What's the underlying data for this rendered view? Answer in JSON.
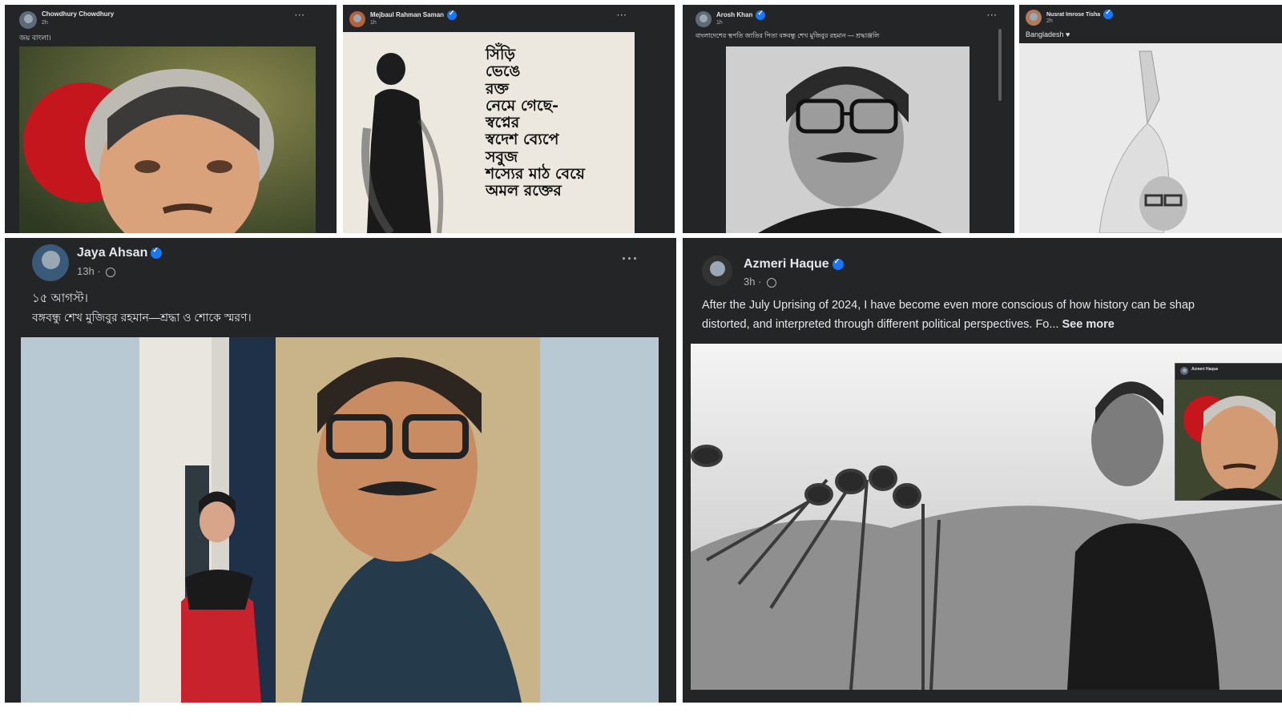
{
  "posts": [
    {
      "name": "Chowdhury Chowdhury",
      "time": "2h",
      "caption": "জয় বাংলা।"
    },
    {
      "name": "Mejbaul Rahman Saman",
      "time": "1h",
      "caption": ""
    },
    {
      "name": "Arosh Khan",
      "time": "1h",
      "caption": "বাংলাদেশের স্থপতি জাতির পিতা বঙ্গবন্ধু শেখ মুজিবুর রহমান — শ্রদ্ধাঞ্জলি"
    },
    {
      "name": "Nusrat Imrose Tisha",
      "time": "2h",
      "caption": "Bangladesh ♥"
    },
    {
      "name": "Jaya Ahsan",
      "time": "13h",
      "caption_line1": "১৫ আগস্ট।",
      "caption_line2": "বঙ্গবন্ধু শেখ মুজিবুর রহমান—শ্রদ্ধা ও শোকে স্মরণ।"
    },
    {
      "name": "Azmeri Haque",
      "time": "3h",
      "caption_line1": "After the July Uprising of 2024, I have become even more conscious of how history can be shap",
      "caption_line2": "distorted, and interpreted through different political perspectives. Fo...",
      "see_more": "See more",
      "inset_name": "Azmeri Haque"
    }
  ],
  "poem": [
    "সিঁড়ি",
    "ভেঙে",
    "রক্ত",
    "নেমে গেছে-",
    "স্বপ্নের",
    "স্বদেশ ব্যেপে",
    "সবুজ",
    "শস্যের মাঠ বেয়ে",
    "অমল রক্তের"
  ],
  "icons": {
    "more": "more-options-icon",
    "privacy": "globe-icon",
    "verified": "verified-badge-icon"
  }
}
